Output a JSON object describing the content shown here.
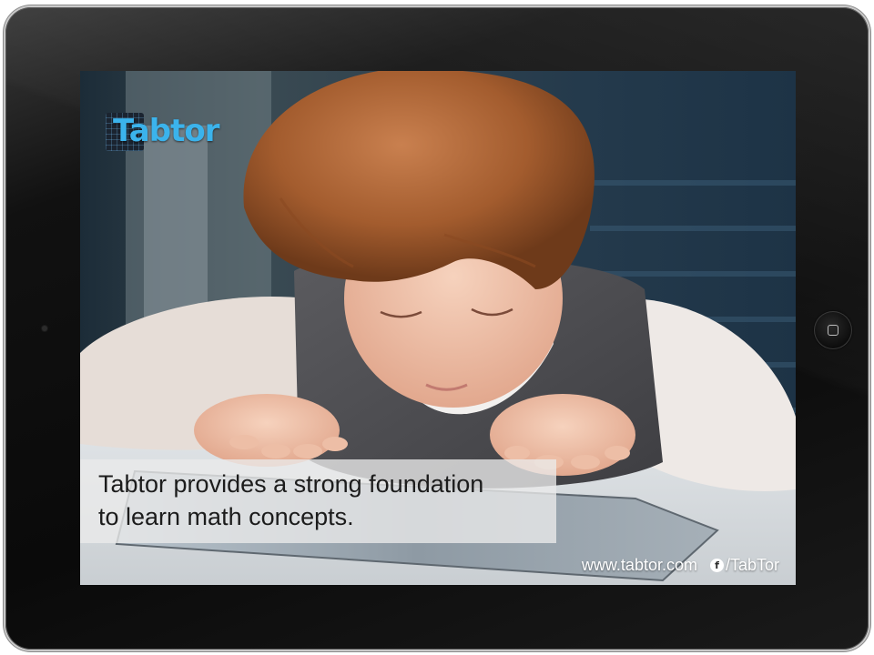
{
  "screen": {
    "logo": {
      "text": "Tabtor",
      "icon": "tabtor-logo"
    },
    "caption": {
      "line1": "Tabtor provides a strong foundation",
      "line2": "to learn math concepts."
    },
    "footer": {
      "website": "www.tabtor.com",
      "facebook_icon": "facebook-icon",
      "facebook_handle": "/TabTor"
    }
  },
  "device": {
    "home_button_icon": "home-button-icon"
  },
  "colors": {
    "brand": "#3bb3ec",
    "bezel": "#0a0a0a",
    "caption_bg": "#ebebeb"
  }
}
